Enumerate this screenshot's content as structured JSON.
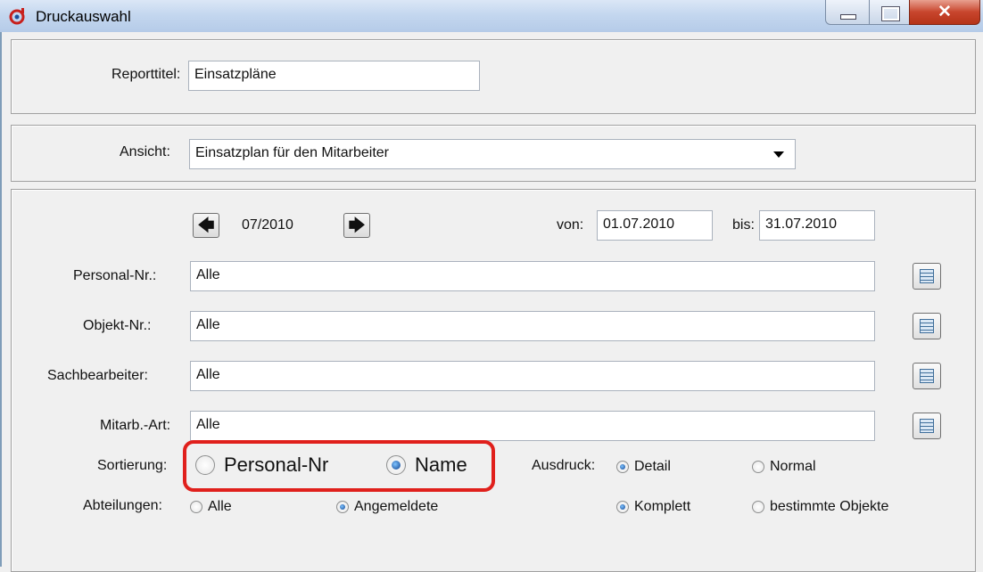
{
  "window": {
    "title": "Druckauswahl"
  },
  "report": {
    "label": "Reporttitel:",
    "value": "Einsatzpläne"
  },
  "view": {
    "label": "Ansicht:",
    "value": "Einsatzplan für den Mitarbeiter"
  },
  "period": {
    "month": "07/2010",
    "from_label": "von:",
    "from": "01.07.2010",
    "to_label": "bis:",
    "to": "31.07.2010"
  },
  "filters": [
    {
      "label": "Personal-Nr.:",
      "value": "Alle"
    },
    {
      "label": "Objekt-Nr.:",
      "value": "Alle"
    },
    {
      "label": "Sachbearbeiter:",
      "value": "Alle"
    },
    {
      "label": "Mitarb.-Art:",
      "value": "Alle"
    }
  ],
  "sort": {
    "label": "Sortierung:",
    "opt1": "Personal-Nr",
    "opt2": "Name",
    "selected": "Name"
  },
  "printout": {
    "label": "Ausdruck:",
    "opt1": "Detail",
    "opt2": "Normal",
    "opt3": "Komplett",
    "opt4": "bestimmte Objekte"
  },
  "departments": {
    "label": "Abteilungen:",
    "opt1": "Alle",
    "opt2": "Angemeldete"
  },
  "colors": {
    "highlight": "#e0201c",
    "titlebar": "#c4d7ef"
  }
}
